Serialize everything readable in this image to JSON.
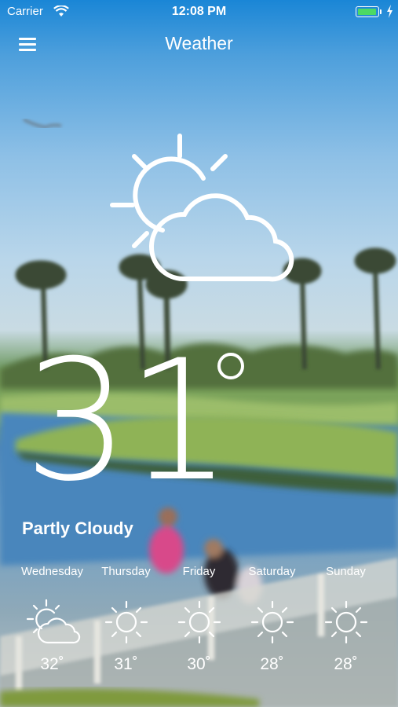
{
  "status": {
    "carrier": "Carrier",
    "time": "12:08 PM",
    "battery_level": 1.0,
    "charging": true
  },
  "nav": {
    "title": "Weather",
    "menu_icon": "hamburger-menu-icon"
  },
  "current": {
    "temperature": "31",
    "condition": "Partly Cloudy",
    "icon": "partly-cloudy-icon"
  },
  "forecast": [
    {
      "day": "Wednesday",
      "temp": "32˚",
      "icon": "partly-cloudy-icon"
    },
    {
      "day": "Thursday",
      "temp": "31˚",
      "icon": "sun-icon"
    },
    {
      "day": "Friday",
      "temp": "30˚",
      "icon": "sun-icon"
    },
    {
      "day": "Saturday",
      "temp": "28˚",
      "icon": "sun-icon"
    },
    {
      "day": "Sunday",
      "temp": "28˚",
      "icon": "sun-icon"
    }
  ],
  "colors": {
    "status_bar": "#1a86d6",
    "battery": "#4cd964",
    "text": "#ffffff"
  }
}
